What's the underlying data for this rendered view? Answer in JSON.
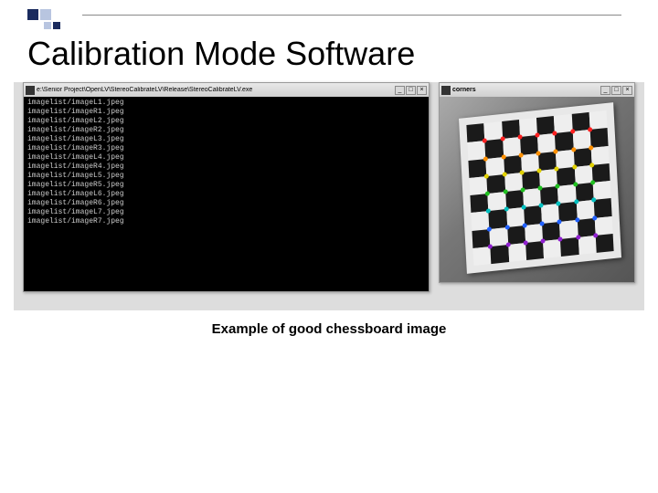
{
  "slide": {
    "title": "Calibration Mode Software",
    "caption": "Example of good chessboard image"
  },
  "console_window": {
    "title": "e:\\Senior Project\\OpenLV\\StereoCalibrateLV\\Release\\StereoCalibrateLV.exe",
    "min_btn": "_",
    "max_btn": "□",
    "close_btn": "×",
    "lines": [
      "imagelist/imageL1.jpeg",
      "imagelist/imageR1.jpeg",
      "imagelist/imageL2.jpeg",
      "imagelist/imageR2.jpeg",
      "imagelist/imageL3.jpeg",
      "imagelist/imageR3.jpeg",
      "imagelist/imageL4.jpeg",
      "imagelist/imageR4.jpeg",
      "imagelist/imageL5.jpeg",
      "imagelist/imageR5.jpeg",
      "imagelist/imageL6.jpeg",
      "imagelist/imageR6.jpeg",
      "imagelist/imageL7.jpeg",
      "imagelist/imageR7.jpeg"
    ]
  },
  "corners_window": {
    "title": "corners",
    "min_btn": "_",
    "max_btn": "□",
    "close_btn": "×",
    "board_size": 8,
    "corner_rows": 7,
    "corner_cols": 7,
    "row_colors": [
      "#ff2020",
      "#ff9000",
      "#e0d000",
      "#20c020",
      "#00c0c0",
      "#2060ff",
      "#9020d0"
    ]
  }
}
